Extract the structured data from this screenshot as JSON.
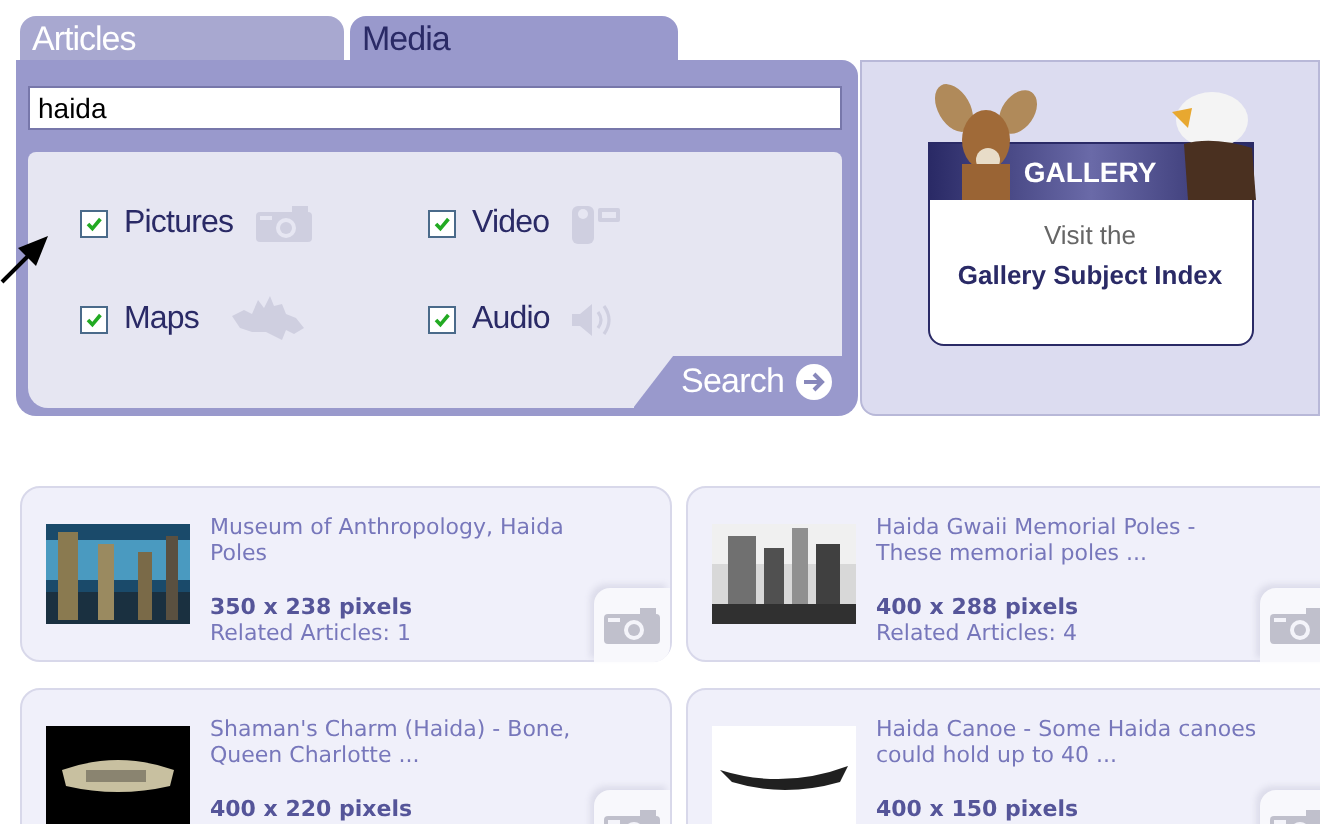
{
  "tabs": [
    {
      "label": "Articles",
      "selected": false
    },
    {
      "label": "Media",
      "selected": true
    }
  ],
  "search": {
    "value": "haida"
  },
  "media_types": [
    {
      "label": "Pictures",
      "checked": true
    },
    {
      "label": "Video",
      "checked": true
    },
    {
      "label": "Maps",
      "checked": true
    },
    {
      "label": "Audio",
      "checked": true
    }
  ],
  "search_button": {
    "label": "Search"
  },
  "gallery": {
    "title": "GALLERY",
    "intro": "Visit the",
    "link": "Gallery Subject Index"
  },
  "results": [
    {
      "title": "Museum of Anthropology, Haida Poles",
      "size": "350 x 238 pixels",
      "related": "Related Articles: 1"
    },
    {
      "title": "Haida Gwaii Memorial Poles - These memorial poles ...",
      "size": "400 x 288 pixels",
      "related": "Related Articles: 4"
    },
    {
      "title": "Shaman's Charm (Haida) - Bone, Queen Charlotte ...",
      "size": "400 x 220 pixels"
    },
    {
      "title": "Haida Canoe - Some Haida canoes could hold up to 40 ...",
      "size": "400 x 150 pixels"
    }
  ]
}
